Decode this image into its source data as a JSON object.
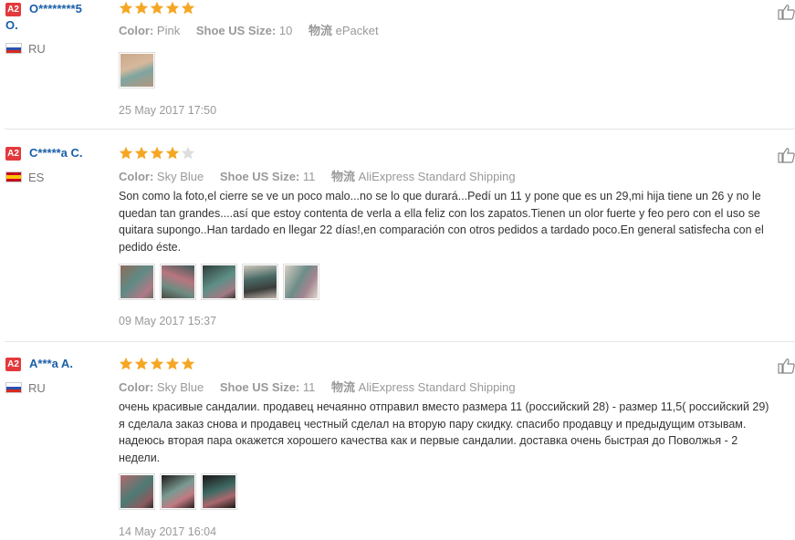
{
  "reviews": [
    {
      "badge": "A2",
      "name": "O********5",
      "name_line2": "O.",
      "country": "RU",
      "stars": 5,
      "color_label": "Color:",
      "color_value": "Pink",
      "size_label": "Shoe US Size:",
      "size_value": "10",
      "ship_label": "物流",
      "ship_value": "ePacket",
      "text": [],
      "photos": [
        "photo-1"
      ],
      "date": "25 May 2017 17:50"
    },
    {
      "badge": "A2",
      "name": "C*****a C.",
      "country": "ES",
      "stars": 4,
      "color_label": "Color:",
      "color_value": "Sky Blue",
      "size_label": "Shoe US Size:",
      "size_value": "11",
      "ship_label": "物流",
      "ship_value": "AliExpress Standard Shipping",
      "text": [
        "Son como la foto,el cierre se ve un poco malo...no se lo que durará...Pedí un 11 y pone que es un 29,mi hija tiene un 26 y no le",
        "quedan tan grandes....así que estoy contenta de verla a ella feliz con los zapatos.Tienen un olor fuerte y feo pero con el uso se",
        "quitara supongo..Han tardado en llegar 22 días!,en comparación con otros pedidos a tardado poco.En general satisfecha con el",
        "pedido éste."
      ],
      "photos": [
        "photo-1",
        "photo-2",
        "photo-3",
        "photo-4",
        "photo-5"
      ],
      "date": "09 May 2017 15:37"
    },
    {
      "badge": "A2",
      "name": "A***a A.",
      "country": "RU",
      "stars": 5,
      "color_label": "Color:",
      "color_value": "Sky Blue",
      "size_label": "Shoe US Size:",
      "size_value": "11",
      "ship_label": "物流",
      "ship_value": "AliExpress Standard Shipping",
      "text": [
        "очень красивые сандалии. продавец нечаянно отправил вместо размера 11 (российский 28) - размер 11,5( российский 29)",
        "я сделала заказ снова и продавец честный сделал на вторую пару скидку. спасибо продавцу и предыдущим отзывам.",
        "надеюсь вторая пара окажется хорошего качества как и первые сандалии. доставка очень быстрая до Поволжья - 2",
        "недели."
      ],
      "photos": [
        "photo-1",
        "photo-2",
        "photo-3"
      ],
      "date": "14 May 2017 16:04"
    }
  ],
  "colors": {
    "accent": "#e4393c",
    "username": "#1a5fa8",
    "star": "#f5a623",
    "star_empty": "#dddddd"
  },
  "icons": [
    "like-icon",
    "star-icon",
    "flag-ru-icon",
    "flag-es-icon"
  ]
}
